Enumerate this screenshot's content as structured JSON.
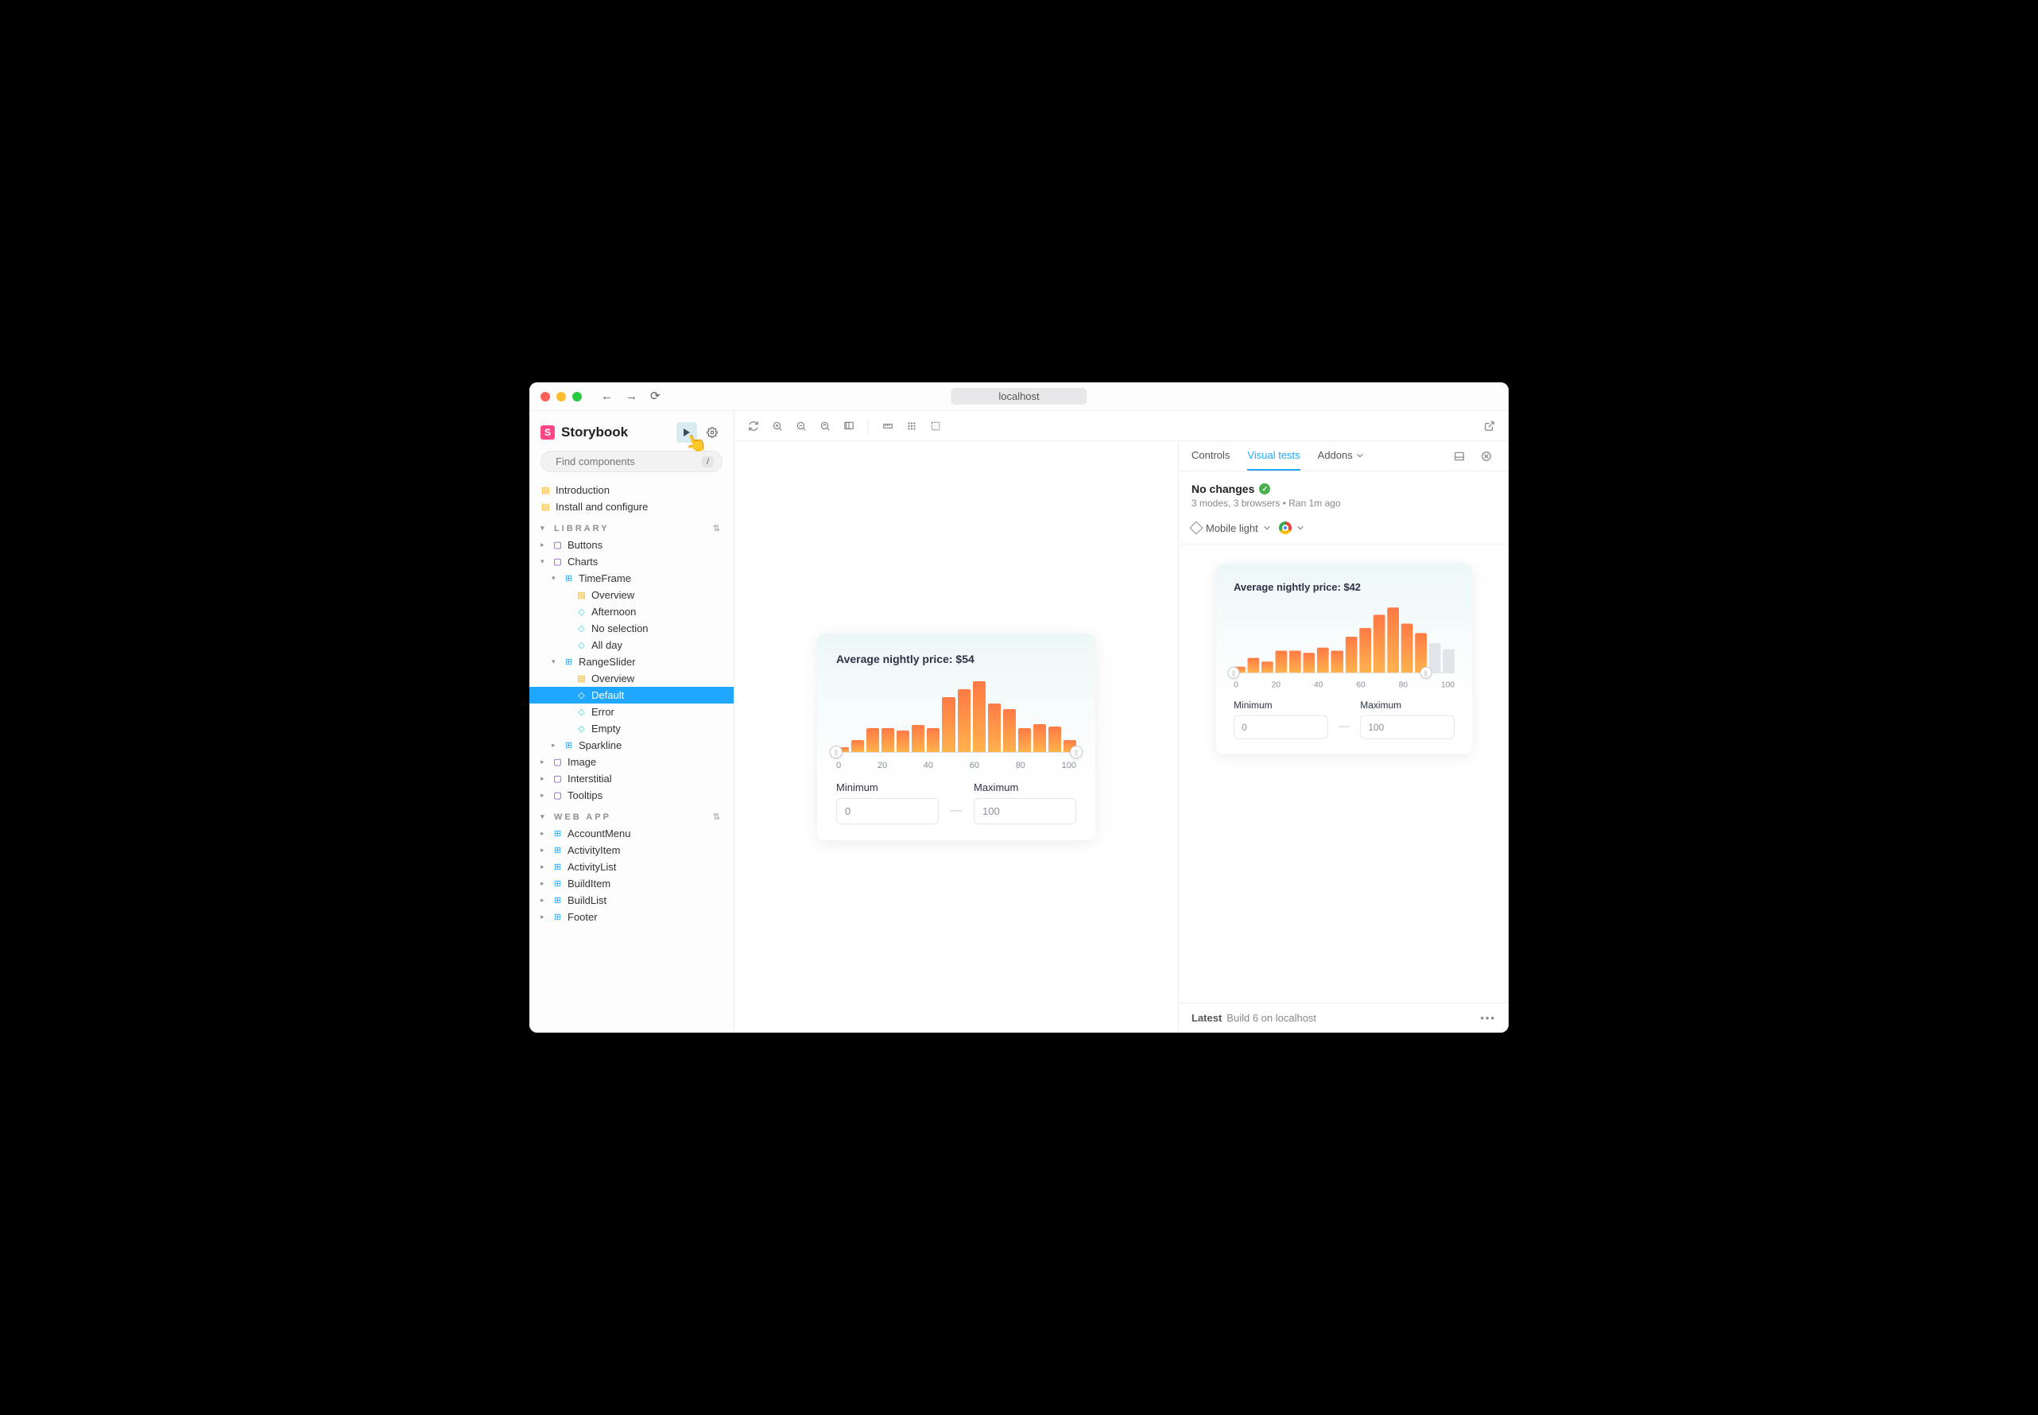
{
  "titlebar": {
    "url": "localhost"
  },
  "brand": {
    "name": "Storybook"
  },
  "search": {
    "placeholder": "Find components",
    "kbd": "/"
  },
  "sidebar": {
    "top_docs": [
      {
        "label": "Introduction"
      },
      {
        "label": "Install and configure"
      }
    ],
    "sections": [
      {
        "title": "LIBRARY",
        "items": [
          {
            "label": "Buttons",
            "type": "folder",
            "depth": 0
          },
          {
            "label": "Charts",
            "type": "folder",
            "depth": 0,
            "expanded": true
          },
          {
            "label": "TimeFrame",
            "type": "component",
            "depth": 1,
            "expanded": true
          },
          {
            "label": "Overview",
            "type": "doc",
            "depth": 2
          },
          {
            "label": "Afternoon",
            "type": "story",
            "depth": 2
          },
          {
            "label": "No selection",
            "type": "story",
            "depth": 2
          },
          {
            "label": "All day",
            "type": "story",
            "depth": 2
          },
          {
            "label": "RangeSlider",
            "type": "component",
            "depth": 1,
            "expanded": true
          },
          {
            "label": "Overview",
            "type": "doc",
            "depth": 2
          },
          {
            "label": "Default",
            "type": "story",
            "depth": 2,
            "selected": true
          },
          {
            "label": "Error",
            "type": "story",
            "depth": 2
          },
          {
            "label": "Empty",
            "type": "story",
            "depth": 2
          },
          {
            "label": "Sparkline",
            "type": "component",
            "depth": 1
          },
          {
            "label": "Image",
            "type": "folder",
            "depth": 0
          },
          {
            "label": "Interstitial",
            "type": "folder",
            "depth": 0
          },
          {
            "label": "Tooltips",
            "type": "folder",
            "depth": 0
          }
        ]
      },
      {
        "title": "WEB APP",
        "items": [
          {
            "label": "AccountMenu",
            "type": "component",
            "depth": 0
          },
          {
            "label": "ActivityItem",
            "type": "component",
            "depth": 0
          },
          {
            "label": "ActivityList",
            "type": "component",
            "depth": 0
          },
          {
            "label": "BuildItem",
            "type": "component",
            "depth": 0
          },
          {
            "label": "BuildList",
            "type": "component",
            "depth": 0
          },
          {
            "label": "Footer",
            "type": "component",
            "depth": 0
          }
        ]
      }
    ]
  },
  "chart_data": [
    {
      "type": "bar",
      "title": "Average nightly price: $54",
      "xlabel": "",
      "ylabel": "",
      "x_ticks": [
        "0",
        "20",
        "40",
        "60",
        "80",
        "100"
      ],
      "categories": [
        "0",
        "7",
        "13",
        "20",
        "27",
        "33",
        "40",
        "47",
        "53",
        "60",
        "67",
        "73",
        "80",
        "87",
        "93",
        "100"
      ],
      "values": [
        6,
        15,
        30,
        30,
        27,
        34,
        30,
        70,
        80,
        90,
        62,
        55,
        30,
        35,
        32,
        15
      ],
      "range": {
        "min": 0,
        "max": 100
      },
      "inputs": {
        "min_label": "Minimum",
        "max_label": "Maximum",
        "min_value": "0",
        "max_value": "100"
      }
    },
    {
      "type": "bar",
      "title": "Average nightly price: $42",
      "xlabel": "",
      "ylabel": "",
      "x_ticks": [
        "0",
        "20",
        "40",
        "60",
        "80",
        "100"
      ],
      "categories": [
        "0",
        "7",
        "13",
        "20",
        "27",
        "33",
        "40",
        "47",
        "53",
        "60",
        "67",
        "73",
        "80",
        "87",
        "93",
        "100"
      ],
      "values": [
        8,
        20,
        15,
        30,
        30,
        27,
        34,
        30,
        50,
        62,
        80,
        90,
        68,
        55,
        40,
        32
      ],
      "range": {
        "min": 0,
        "max": 87
      },
      "inputs": {
        "min_label": "Minimum",
        "max_label": "Maximum",
        "min_value": "0",
        "max_value": "100"
      }
    }
  ],
  "addon": {
    "tabs": {
      "controls": "Controls",
      "visual": "Visual tests",
      "addons": "Addons"
    },
    "status": {
      "title": "No changes",
      "sub": "3 modes, 3 browsers • Ran 1m ago"
    },
    "mode": {
      "label": "Mobile light"
    },
    "footer": {
      "latest": "Latest",
      "build": "Build 6 on localhost"
    }
  }
}
